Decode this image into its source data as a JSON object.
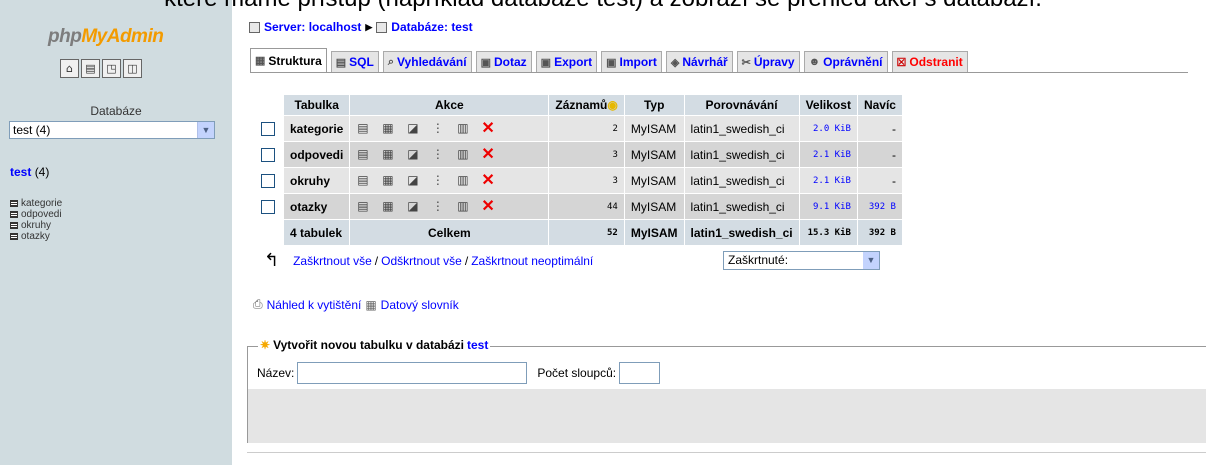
{
  "caption": "které máme přístup (například databáze test) a zobrazí se přehled akcí s databází.",
  "left": {
    "logo_php": "php",
    "logo_my": "MyAdmin",
    "icons": [
      "home-icon",
      "sql-icon",
      "query-icon",
      "docs-icon"
    ],
    "db_label": "Databáze",
    "db_select": "test (4)",
    "db_name": "test",
    "db_count": "(4)",
    "tables": [
      "kategorie",
      "odpovedi",
      "okruhy",
      "otazky"
    ]
  },
  "breadcrumb": {
    "server": "Server: localhost",
    "database": "Databáze: test"
  },
  "tabs": [
    {
      "label": "Struktura",
      "icon": "structure-icon",
      "active": true
    },
    {
      "label": "SQL",
      "icon": "sql-icon"
    },
    {
      "label": "Vyhledávání",
      "icon": "search-icon"
    },
    {
      "label": "Dotaz",
      "icon": "query-icon"
    },
    {
      "label": "Export",
      "icon": "export-icon"
    },
    {
      "label": "Import",
      "icon": "import-icon"
    },
    {
      "label": "Návrhář",
      "icon": "designer-icon"
    },
    {
      "label": "Úpravy",
      "icon": "operations-icon"
    },
    {
      "label": "Oprávnění",
      "icon": "privileges-icon"
    },
    {
      "label": "Odstranit",
      "icon": "drop-icon",
      "danger": true
    }
  ],
  "table": {
    "headers": {
      "tabulka": "Tabulka",
      "akce": "Akce",
      "zaznamu": "Záznamů",
      "typ": "Typ",
      "porovnavani": "Porovnávání",
      "velikost": "Velikost",
      "navic": "Navíc"
    },
    "rows": [
      {
        "name": "kategorie",
        "records": "2",
        "type": "MyISAM",
        "collation": "latin1_swedish_ci",
        "size": "2.0 KiB",
        "overhead": "-"
      },
      {
        "name": "odpovedi",
        "records": "3",
        "type": "MyISAM",
        "collation": "latin1_swedish_ci",
        "size": "2.1 KiB",
        "overhead": "-"
      },
      {
        "name": "okruhy",
        "records": "3",
        "type": "MyISAM",
        "collation": "latin1_swedish_ci",
        "size": "2.1 KiB",
        "overhead": "-"
      },
      {
        "name": "otazky",
        "records": "44",
        "type": "MyISAM",
        "collation": "latin1_swedish_ci",
        "size": "9.1 KiB",
        "overhead": "392 B"
      }
    ],
    "summary": {
      "name": "4 tabulek",
      "label": "Celkem",
      "records": "52",
      "type": "MyISAM",
      "collation": "latin1_swedish_ci",
      "size": "15.3 KiB",
      "overhead": "392 B"
    }
  },
  "bulk": {
    "check_all": "Zaškrtnout vše",
    "uncheck_all": "Odškrtnout vše",
    "check_overhead": "Zaškrtnout neoptimální",
    "with_selected": "Zaškrtnuté:"
  },
  "links": {
    "print": "Náhled k vytištění",
    "dictionary": "Datový slovník"
  },
  "create": {
    "legend_prefix": "Vytvořit novou tabulku v databázi",
    "legend_db": "test",
    "name_label": "Název:",
    "cols_label": "Počet sloupců:"
  },
  "colors": {
    "left_bg": "#d0dce0",
    "header_bg": "#d3dce3",
    "link": "#0000ff",
    "danger": "#ff0000"
  }
}
